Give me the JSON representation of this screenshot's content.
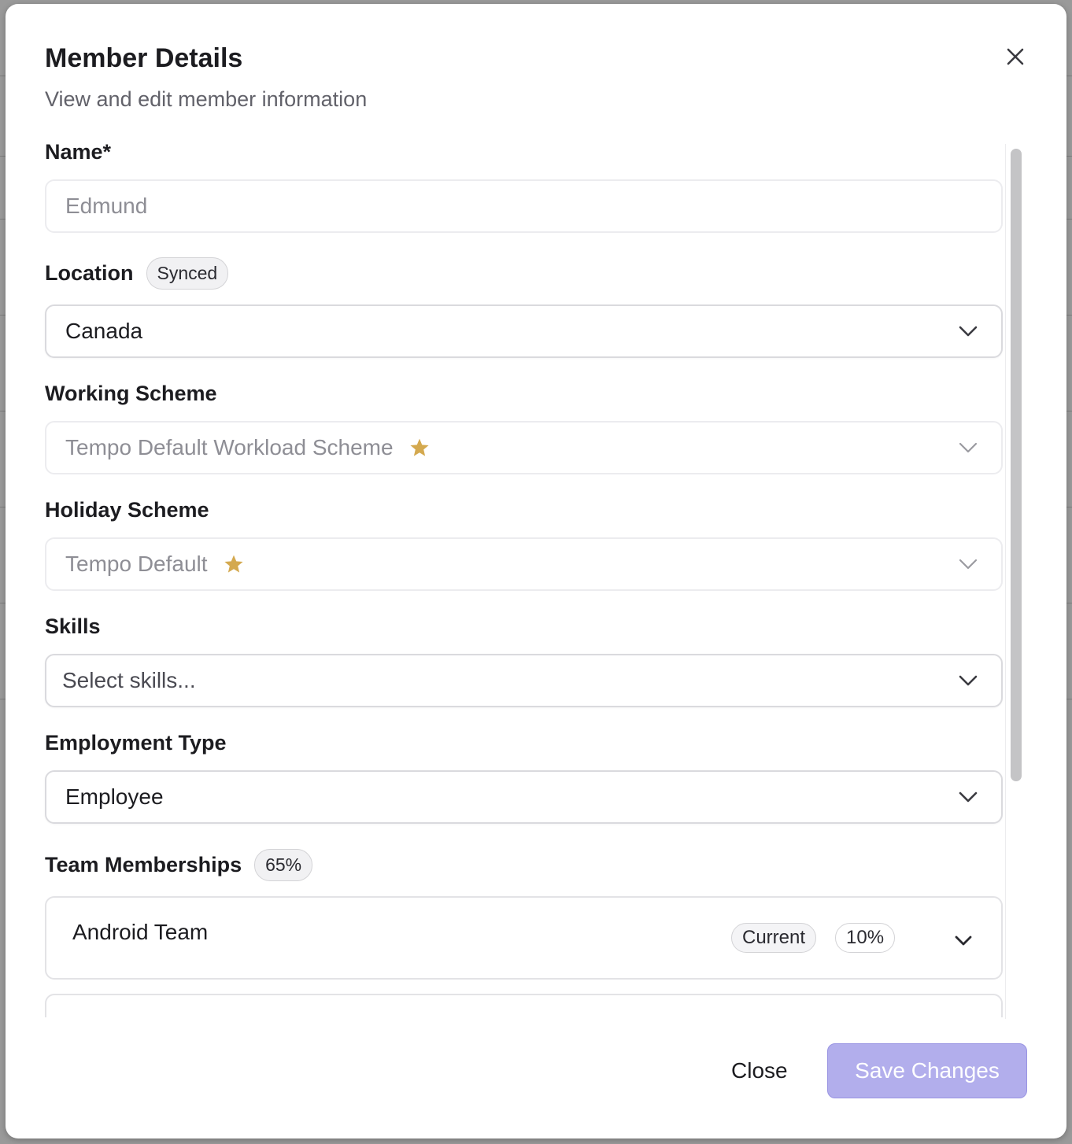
{
  "dialog": {
    "title": "Member Details",
    "subtitle": "View and edit member information"
  },
  "fields": {
    "name": {
      "label": "Name*",
      "placeholder": "Edmund"
    },
    "location": {
      "label": "Location",
      "badge": "Synced",
      "value": "Canada"
    },
    "working_scheme": {
      "label": "Working Scheme",
      "value": "Tempo Default Workload Scheme"
    },
    "holiday_scheme": {
      "label": "Holiday Scheme",
      "value": "Tempo Default"
    },
    "skills": {
      "label": "Skills",
      "placeholder": "Select skills..."
    },
    "employment_type": {
      "label": "Employment Type",
      "value": "Employee"
    }
  },
  "team_memberships": {
    "label": "Team Memberships",
    "total_badge": "65%",
    "teams": [
      {
        "name": "Android Team",
        "status": "Current",
        "allocation": "10%"
      }
    ]
  },
  "footer": {
    "close_label": "Close",
    "save_label": "Save Changes"
  },
  "colors": {
    "accent_disabled": "#b2aeec",
    "star": "#d4a94f"
  }
}
